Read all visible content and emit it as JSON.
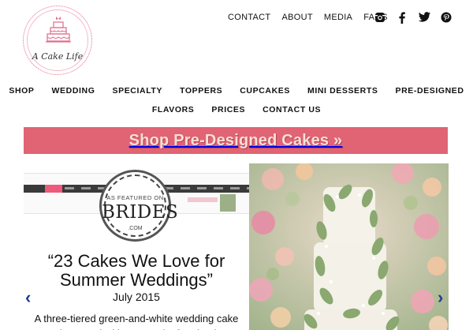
{
  "logo": {
    "text": "A Cake Life",
    "icon": "cake-icon"
  },
  "top_nav": [
    "CONTACT",
    "ABOUT",
    "MEDIA",
    "FAQS"
  ],
  "social": [
    "instagram-icon",
    "facebook-icon",
    "twitter-icon",
    "pinterest-icon"
  ],
  "main_nav": {
    "row1": [
      "SHOP",
      "WEDDING",
      "SPECIALTY",
      "TOPPERS",
      "CUPCAKES",
      "MINI DESSERTS",
      "PRE-DESIGNED"
    ],
    "row2": [
      "FLAVORS",
      "PRICES",
      "CONTACT US"
    ]
  },
  "banner": {
    "label": "Shop Pre-Designed Cakes »",
    "color": "#e06474"
  },
  "slide": {
    "seal_top": "AS FEATURED ON",
    "seal_brand": "BRIDES",
    "seal_bottom": ".COM",
    "quote": "“23 Cakes We Love for Summer Weddings”",
    "date": "July 2015",
    "description": "A three-tiered green-and-white wedding cake decorated with a sugar leaf garland"
  },
  "slider_arrows": {
    "prev": "‹",
    "next": "›"
  }
}
